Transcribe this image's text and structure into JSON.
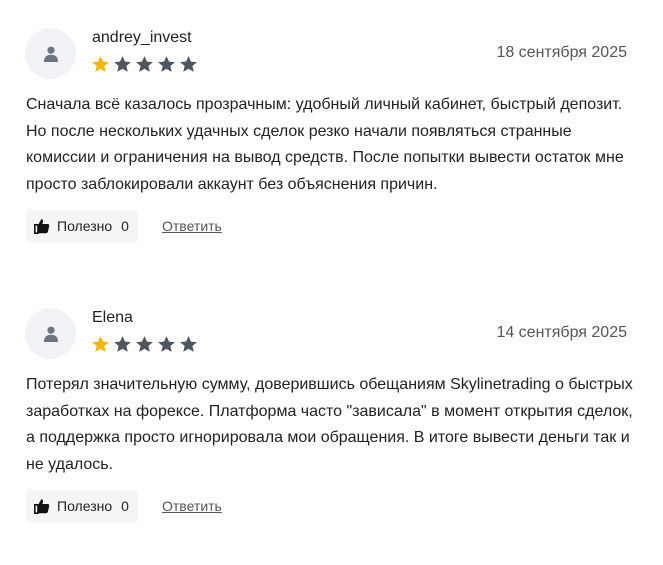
{
  "reviews": [
    {
      "author": "andrey_invest",
      "date": "18 сентября 2025",
      "rating": 1,
      "max_rating": 5,
      "text": "Сначала всё казалось прозрачным: удобный личный кабинет, быстрый депозит. Но после нескольких удачных сделок резко начали появляться странные комиссии и ограничения на вывод средств. После попытки вывести остаток мне просто заблокировали аккаунт без объяснения причин.",
      "helpful_label": "Полезно",
      "helpful_count": "0",
      "reply_label": "Ответить"
    },
    {
      "author": "Elena",
      "date": "14 сентября 2025",
      "rating": 1,
      "max_rating": 5,
      "text": "Потерял значительную сумму, доверившись обещаниям Skylinetrading о быстрых заработках на форексе. Платформа часто \"зависала\" в момент открытия сделок, а поддержка просто игнорировала мои обращения. В итоге вывести деньги так и не удалось.",
      "helpful_label": "Полезно",
      "helpful_count": "0",
      "reply_label": "Ответить"
    }
  ],
  "colors": {
    "star_filled": "#f5b800",
    "star_empty": "#4d555e",
    "avatar_bg": "#f0f2f5",
    "avatar_icon": "#6b7580",
    "helpful_bg": "#f4f5f7"
  },
  "icons": {
    "avatar": "user-icon",
    "star": "star-icon",
    "helpful": "thumbs-up-icon"
  }
}
